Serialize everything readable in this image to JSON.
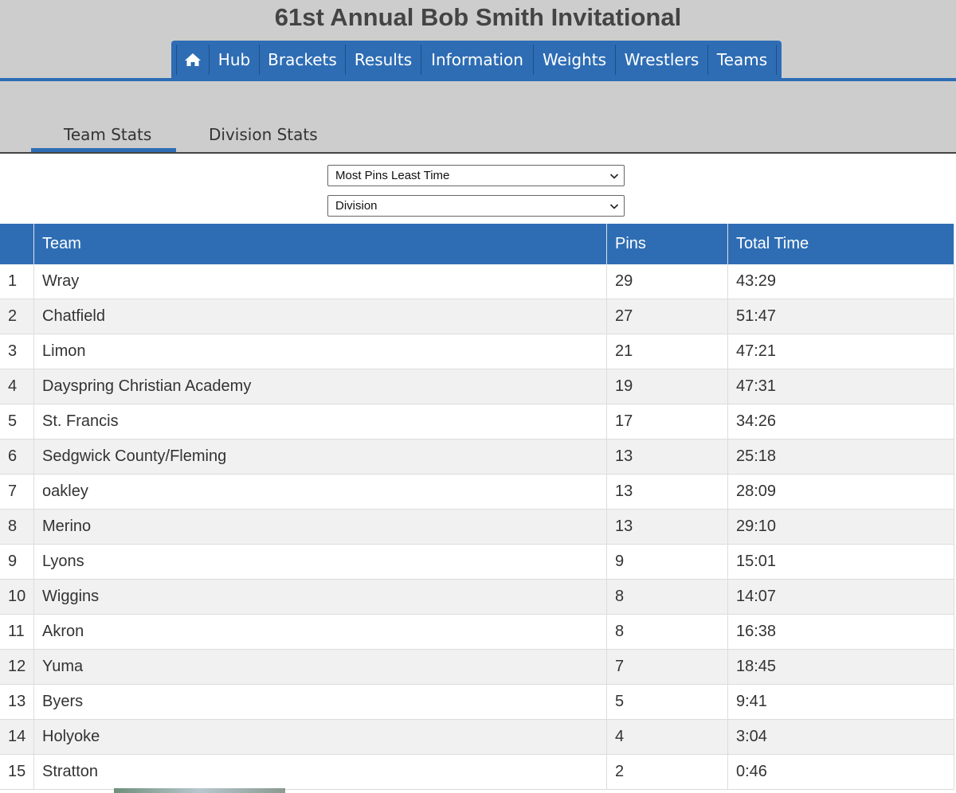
{
  "title": "61st Annual Bob Smith Invitational",
  "nav": {
    "home_icon": "home-icon",
    "items": [
      "Hub",
      "Brackets",
      "Results",
      "Information",
      "Weights",
      "Wrestlers",
      "Teams"
    ]
  },
  "tabs": {
    "team_stats": "Team Stats",
    "division_stats": "Division Stats"
  },
  "filters": {
    "stat_select": "Most Pins Least Time",
    "division_select": "Division"
  },
  "table": {
    "headers": {
      "rank": "",
      "team": "Team",
      "pins": "Pins",
      "time": "Total Time"
    },
    "rows": [
      {
        "rank": "1",
        "team": "Wray",
        "pins": "29",
        "time": "43:29"
      },
      {
        "rank": "2",
        "team": "Chatfield",
        "pins": "27",
        "time": "51:47"
      },
      {
        "rank": "3",
        "team": "Limon",
        "pins": "21",
        "time": "47:21"
      },
      {
        "rank": "4",
        "team": "Dayspring Christian Academy",
        "pins": "19",
        "time": "47:31"
      },
      {
        "rank": "5",
        "team": "St. Francis",
        "pins": "17",
        "time": "34:26"
      },
      {
        "rank": "6",
        "team": "Sedgwick County/Fleming",
        "pins": "13",
        "time": "25:18"
      },
      {
        "rank": "7",
        "team": "oakley",
        "pins": "13",
        "time": "28:09"
      },
      {
        "rank": "8",
        "team": "Merino",
        "pins": "13",
        "time": "29:10"
      },
      {
        "rank": "9",
        "team": "Lyons",
        "pins": "9",
        "time": "15:01"
      },
      {
        "rank": "10",
        "team": "Wiggins",
        "pins": "8",
        "time": "14:07"
      },
      {
        "rank": "11",
        "team": "Akron",
        "pins": "8",
        "time": "16:38"
      },
      {
        "rank": "12",
        "team": "Yuma",
        "pins": "7",
        "time": "18:45"
      },
      {
        "rank": "13",
        "team": "Byers",
        "pins": "5",
        "time": "9:41"
      },
      {
        "rank": "14",
        "team": "Holyoke",
        "pins": "4",
        "time": "3:04"
      },
      {
        "rank": "15",
        "team": "Stratton",
        "pins": "2",
        "time": "0:46"
      }
    ]
  },
  "colors": {
    "accent": "#2e6db4",
    "header_bg": "#cdcdcd",
    "row_alt": "#f1f1f1"
  }
}
